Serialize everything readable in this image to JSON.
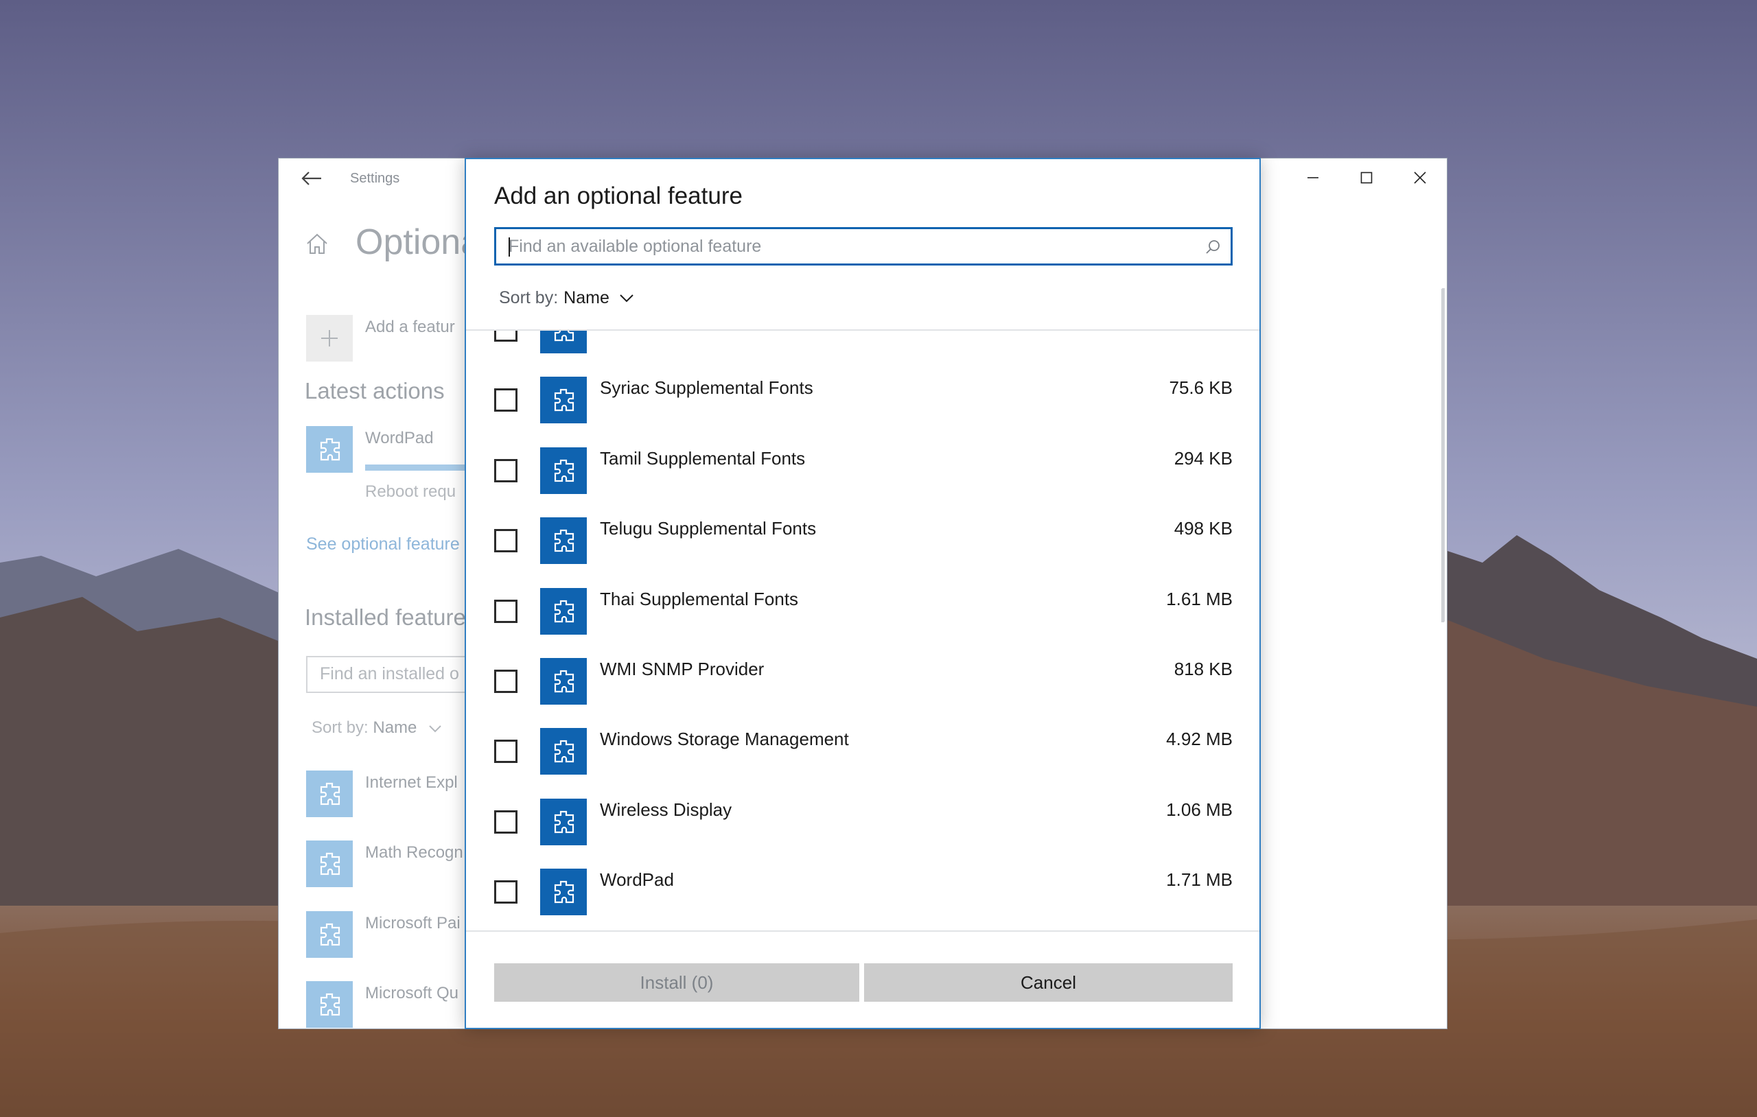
{
  "settings_window": {
    "title": "Settings",
    "heading": "Optiona",
    "add_feature_label": "Add a featur",
    "latest_actions_label": "Latest actions",
    "latest_item": "WordPad",
    "latest_item_status": "Reboot requ",
    "see_optional_link": "See optional feature",
    "installed_features_label": "Installed feature",
    "installed_search_placeholder": "Find an installed o",
    "sort_prefix": "Sort by:",
    "sort_value": "Name",
    "installed_items": [
      "Internet Expl",
      "Math Recogn",
      "Microsoft Pai",
      "Microsoft Qu"
    ]
  },
  "dialog": {
    "title": "Add an optional feature",
    "search_placeholder": "Find an available optional feature",
    "sort_prefix": "Sort by:",
    "sort_value": "Name",
    "features": [
      {
        "name": "Syriac Supplemental Fonts",
        "size": "75.6 KB"
      },
      {
        "name": "Tamil Supplemental Fonts",
        "size": "294 KB"
      },
      {
        "name": "Telugu Supplemental Fonts",
        "size": "498 KB"
      },
      {
        "name": "Thai Supplemental Fonts",
        "size": "1.61 MB"
      },
      {
        "name": "WMI SNMP Provider",
        "size": "818 KB"
      },
      {
        "name": "Windows Storage Management",
        "size": "4.92 MB"
      },
      {
        "name": "Wireless Display",
        "size": "1.06 MB"
      },
      {
        "name": "WordPad",
        "size": "1.71 MB"
      }
    ],
    "install_label": "Install (0)",
    "cancel_label": "Cancel"
  },
  "icons": {
    "feature": "puzzle-icon",
    "back": "back-arrow-icon",
    "home": "home-icon",
    "minimize": "minimize-icon",
    "maximize": "maximize-icon",
    "close": "close-icon",
    "search": "search-icon",
    "sort": "chevron-down-icon",
    "add": "plus-icon"
  },
  "colors": {
    "accent": "#0f63b0",
    "accent_dim": "#9cc5e6",
    "button_gray": "#cccccc"
  }
}
